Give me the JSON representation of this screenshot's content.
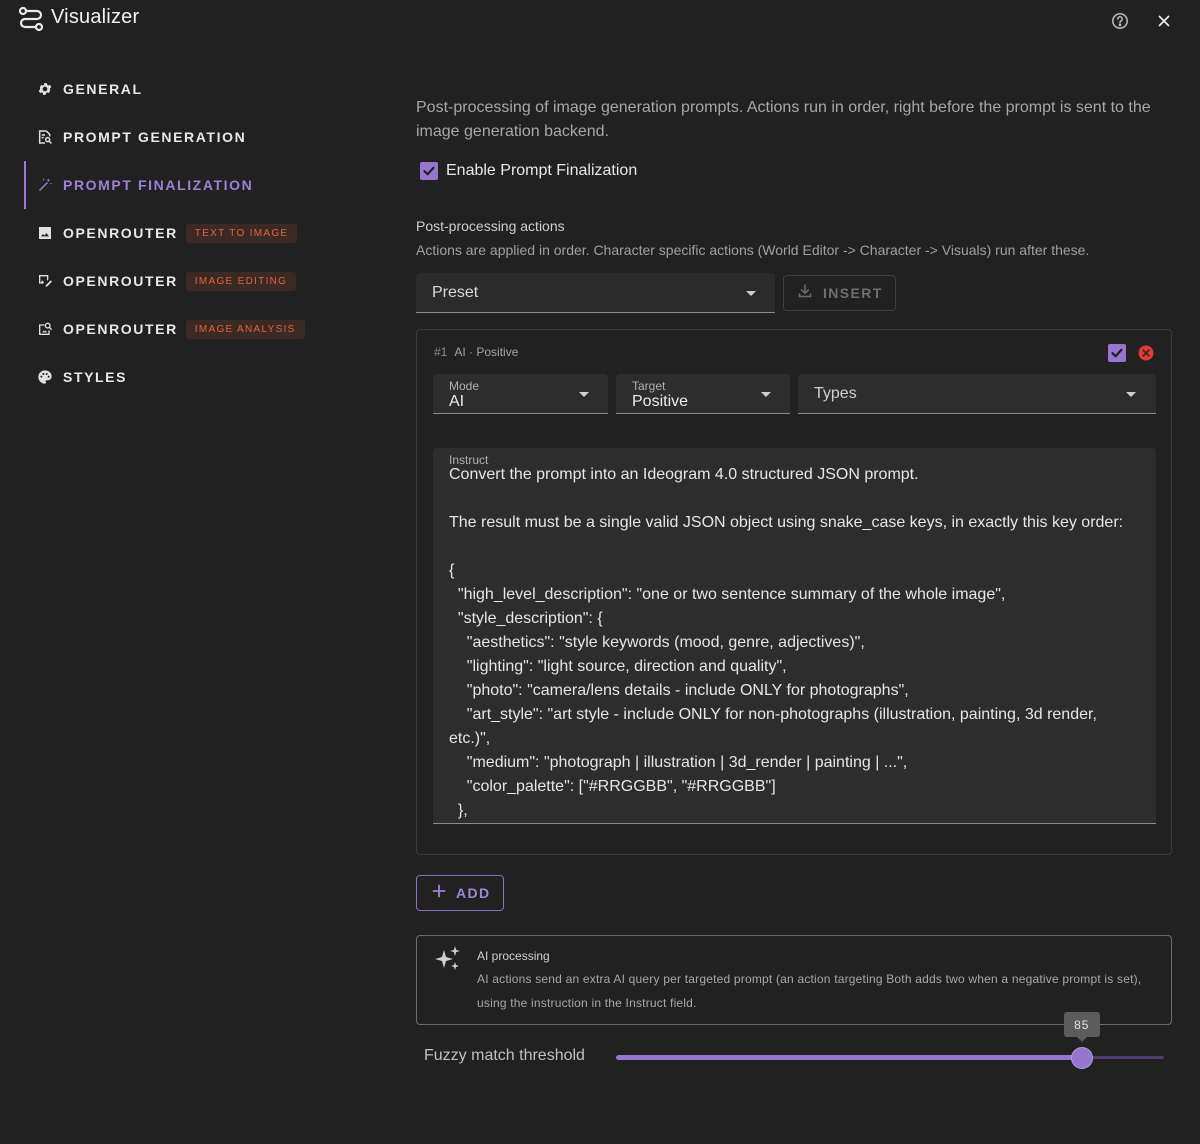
{
  "app": {
    "title": "Visualizer",
    "icon": "route-icon"
  },
  "sidebar": {
    "items": [
      {
        "label": "GENERAL",
        "icon": "gear-icon",
        "active": false
      },
      {
        "label": "PROMPT GENERATION",
        "icon": "document-search-icon",
        "active": false
      },
      {
        "label": "PROMPT FINALIZATION",
        "icon": "magic-wand-icon",
        "active": true
      },
      {
        "label": "OPENROUTER",
        "chip": "TEXT TO IMAGE",
        "icon": "image-icon",
        "active": false
      },
      {
        "label": "OPENROUTER",
        "chip": "IMAGE EDITING",
        "icon": "image-edit-icon",
        "active": false
      },
      {
        "label": "OPENROUTER",
        "chip": "IMAGE ANALYSIS",
        "icon": "image-search-icon",
        "active": false
      },
      {
        "label": "STYLES",
        "icon": "palette-icon",
        "active": false
      }
    ]
  },
  "main": {
    "intro": "Post-processing of image generation prompts. Actions run in order, right before the prompt is sent to the image generation backend.",
    "enable_label": "Enable Prompt Finalization",
    "enable_checked": true,
    "section_title": "Post-processing actions",
    "section_sub": "Actions are applied in order. Character specific actions (World Editor -> Character -> Visuals) run after these.",
    "preset_label": "Preset",
    "insert_label": "INSERT",
    "action": {
      "number": "#1",
      "summary": "AI · Positive",
      "enabled": true,
      "mode_label": "Mode",
      "mode_value": "AI",
      "target_label": "Target",
      "target_value": "Positive",
      "types_placeholder": "Types",
      "instruct_label": "Instruct",
      "instruct_text": "Convert the prompt into an Ideogram 4.0 structured JSON prompt.\n\nThe result must be a single valid JSON object using snake_case keys, in exactly this key order:\n\n{\n  \"high_level_description\": \"one or two sentence summary of the whole image\",\n  \"style_description\": {\n    \"aesthetics\": \"style keywords (mood, genre, adjectives)\",\n    \"lighting\": \"light source, direction and quality\",\n    \"photo\": \"camera/lens details - include ONLY for photographs\",\n    \"art_style\": \"art style - include ONLY for non-photographs (illustration, painting, 3d render, etc.)\",\n    \"medium\": \"photograph | illustration | 3d_render | painting | ...\",\n    \"color_palette\": [\"#RRGGBB\", \"#RRGGBB\"]\n  },"
    },
    "add_label": "ADD",
    "info": {
      "title": "AI processing",
      "text": "AI actions send an extra AI query per targeted prompt (an action targeting Both adds two when a negative prompt is set), using the instruction in the Instruct field."
    },
    "fuzzy": {
      "label": "Fuzzy match threshold",
      "value": "85",
      "min": 0,
      "max": 100
    }
  },
  "colors": {
    "background": "#212121",
    "accent": "#9575cd",
    "chip_text": "#e2623f",
    "delete": "#e53935"
  }
}
